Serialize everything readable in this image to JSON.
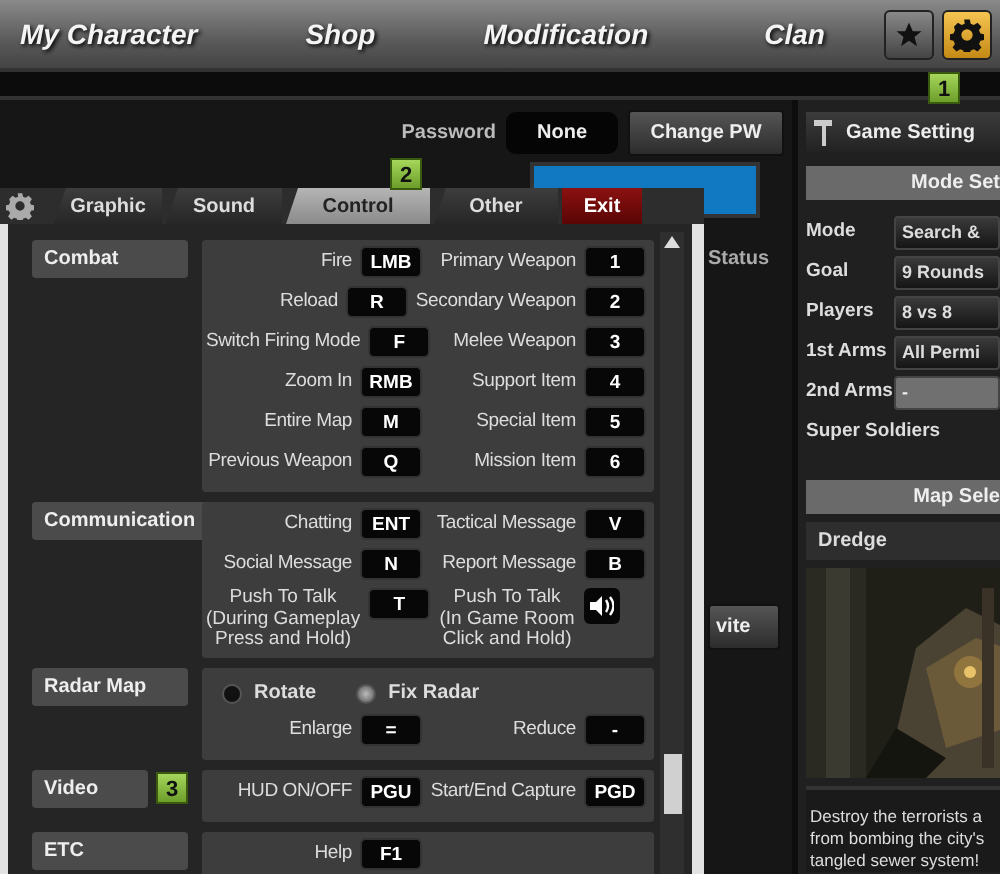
{
  "top_nav": {
    "tabs": [
      {
        "label": "My Character"
      },
      {
        "label": "Shop"
      },
      {
        "label": "Modification"
      },
      {
        "label": "Clan"
      }
    ],
    "icon_buttons": [
      {
        "kind": "star",
        "selected": false
      },
      {
        "kind": "settings",
        "selected": true
      }
    ],
    "callout": "1"
  },
  "room": {
    "password_label": "Password",
    "password_value": "None",
    "change_button": "Change PW",
    "column_header": "Status",
    "invite_button": "vite"
  },
  "game_setting": {
    "title": "Game Setting",
    "mode_header": "Mode Set",
    "rows": [
      {
        "kind": "select",
        "label": "Mode",
        "value": "Search &",
        "disabled": false
      },
      {
        "kind": "select",
        "label": "Goal",
        "value": "9 Rounds",
        "disabled": false
      },
      {
        "kind": "select",
        "label": "Players",
        "value": "8 vs 8",
        "disabled": false
      },
      {
        "kind": "select",
        "label": "1st Arms",
        "value": "All Permi",
        "disabled": false
      },
      {
        "kind": "select",
        "label": "2nd Arms",
        "value": "-",
        "disabled": true
      },
      {
        "kind": "toggle",
        "label": "Super Soldiers"
      }
    ],
    "map_header": "Map Sele",
    "map_name": "Dredge",
    "map_picture": {
      "kind": "picture"
    },
    "description": [
      "Destroy the terrorists a",
      "from bombing the city's",
      "tangled sewer system!"
    ]
  },
  "dialog": {
    "tabs": [
      {
        "label": "Graphic",
        "selected": false
      },
      {
        "label": "Sound",
        "selected": false
      },
      {
        "label": "Control",
        "selected": true
      },
      {
        "label": "Other",
        "selected": false
      }
    ],
    "exit_button": "Exit",
    "callout": "2",
    "sections": [
      {
        "title": "Combat",
        "rows": [
          {
            "kind": "keys",
            "items": [
              {
                "label": "Fire",
                "key": "LMB"
              },
              {
                "label": "Primary Weapon",
                "key": "1"
              }
            ]
          },
          {
            "kind": "keys",
            "items": [
              {
                "label": "Reload",
                "key": "R"
              },
              {
                "label": "Secondary Weapon",
                "key": "2"
              }
            ]
          },
          {
            "kind": "keys",
            "items": [
              {
                "label": "Switch Firing Mode",
                "key": "F"
              },
              {
                "label": "Melee Weapon",
                "key": "3"
              }
            ]
          },
          {
            "kind": "keys",
            "items": [
              {
                "label": "Zoom In",
                "key": "RMB"
              },
              {
                "label": "Support Item",
                "key": "4"
              }
            ]
          },
          {
            "kind": "keys",
            "items": [
              {
                "label": "Entire Map",
                "key": "M"
              },
              {
                "label": "Special Item",
                "key": "5"
              }
            ]
          },
          {
            "kind": "keys",
            "items": [
              {
                "label": "Previous Weapon",
                "key": "Q"
              },
              {
                "label": "Mission Item",
                "key": "6"
              }
            ]
          }
        ]
      },
      {
        "title": "Communication",
        "rows": [
          {
            "kind": "keys",
            "items": [
              {
                "label": "Chatting",
                "key": "ENT"
              },
              {
                "label": "Tactical Message",
                "key": "V"
              }
            ]
          },
          {
            "kind": "keys",
            "items": [
              {
                "label": "Social Message",
                "key": "N"
              },
              {
                "label": "Report Message",
                "key": "B"
              }
            ]
          },
          {
            "kind": "keys",
            "items": [
              {
                "kind": "key",
                "label": "Push To Talk",
                "note": [
                  "(During Gameplay",
                  "Press and Hold)"
                ],
                "key": "T"
              },
              {
                "kind": "speaker",
                "label": "Push To Talk",
                "note": [
                  "(In Game Room",
                  "Click and Hold)"
                ]
              }
            ]
          }
        ]
      },
      {
        "title": "Radar Map",
        "rows": [
          {
            "kind": "radio",
            "options": [
              {
                "label": "Rotate",
                "selected": false
              },
              {
                "label": "Fix Radar",
                "selected": true
              }
            ]
          },
          {
            "kind": "keys",
            "items": [
              {
                "label": "Enlarge",
                "key": "="
              },
              {
                "label": "Reduce",
                "key": "-"
              }
            ]
          }
        ]
      },
      {
        "title": "Video",
        "callout": "3",
        "rows": [
          {
            "kind": "keys",
            "items": [
              {
                "label": "HUD ON/OFF",
                "key": "PGU"
              },
              {
                "label": "Start/End Capture",
                "key": "PGD"
              }
            ]
          }
        ]
      },
      {
        "title": "ETC",
        "rows": [
          {
            "kind": "keys",
            "items": [
              {
                "label": "Help",
                "key": "F1"
              }
            ]
          }
        ]
      }
    ]
  }
}
